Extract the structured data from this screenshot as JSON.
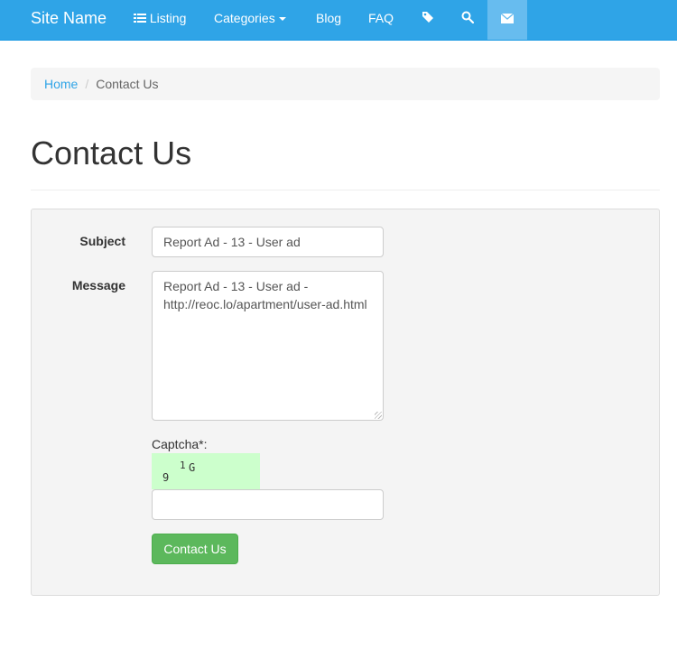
{
  "navbar": {
    "brand": "Site Name",
    "items": [
      {
        "label": "Listing",
        "icon": "list-icon"
      },
      {
        "label": "Categories",
        "icon": "caret-down-icon"
      },
      {
        "label": "Blog"
      },
      {
        "label": "FAQ"
      },
      {
        "icon": "tag-icon"
      },
      {
        "icon": "search-icon"
      },
      {
        "icon": "envelope-icon",
        "active": true
      }
    ],
    "color": "#2fa4e7"
  },
  "breadcrumb": {
    "home": "Home",
    "separator": "/",
    "current": "Contact Us"
  },
  "page": {
    "title": "Contact Us"
  },
  "form": {
    "subject_label": "Subject",
    "subject_value": "Report Ad - 13 - User ad",
    "message_label": "Message",
    "message_value": "Report Ad - 13 - User ad - http://reoc.lo/apartment/user-ad.html",
    "captcha_label": "Captcha*:",
    "captcha_value": "",
    "captcha_chars": [
      "9",
      "1",
      "G"
    ],
    "submit_label": "Contact Us",
    "submit_color": "#5cb85c"
  }
}
